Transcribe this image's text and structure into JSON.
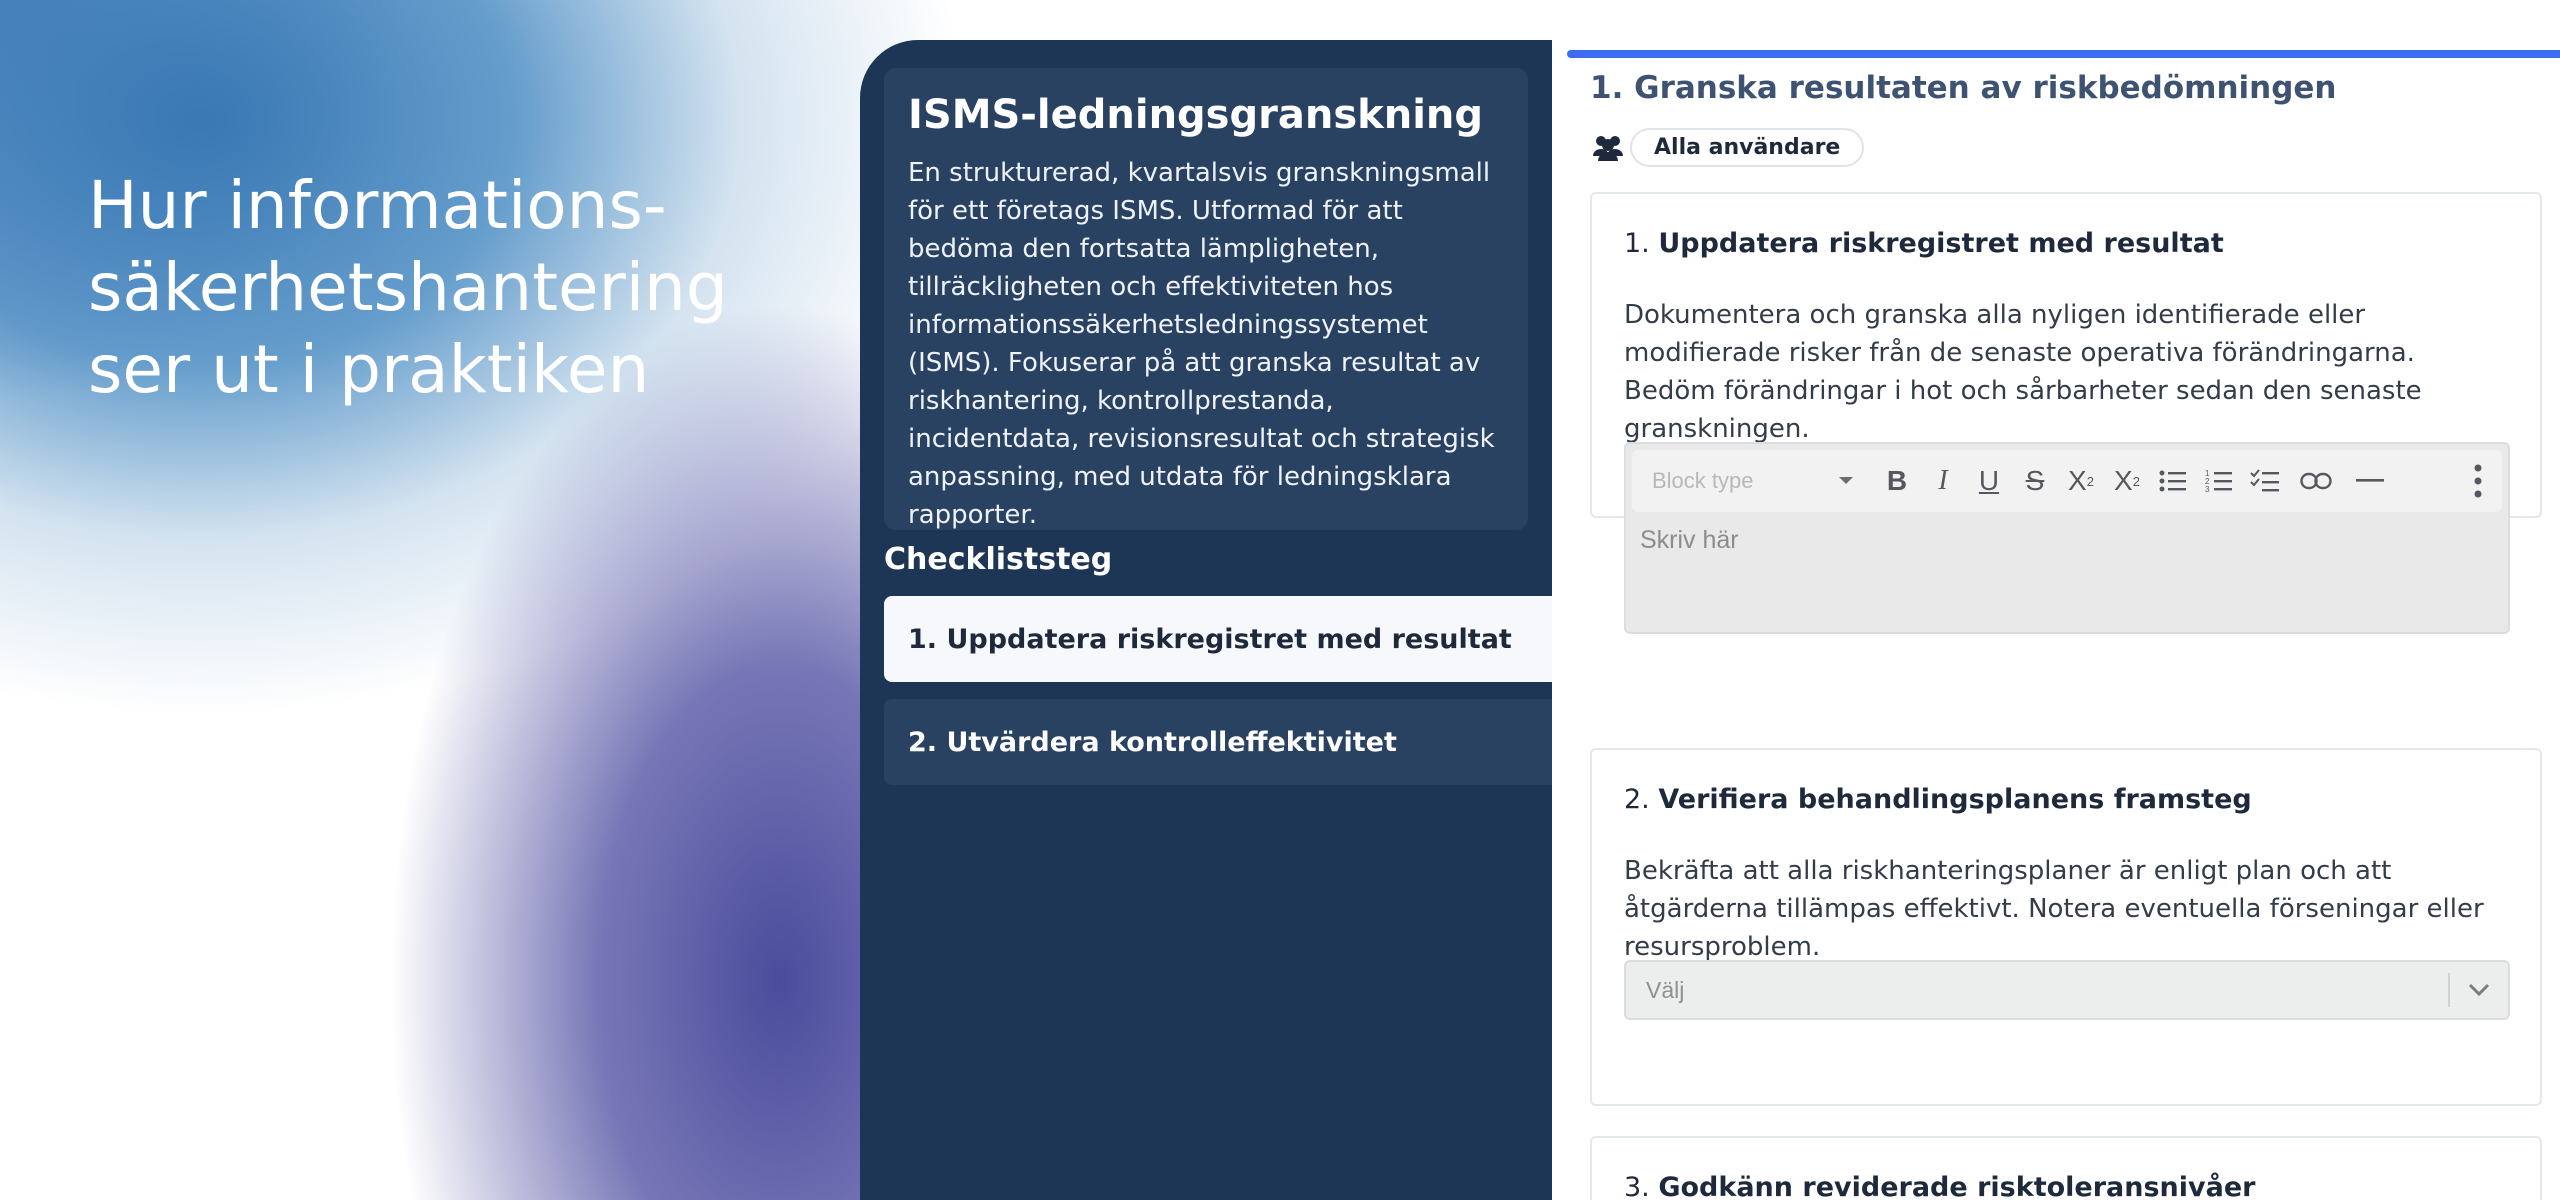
{
  "hero": {
    "line1": "Hur informations-",
    "line2": "säkerhetshantering",
    "line3": "ser ut i praktiken"
  },
  "sidebar": {
    "title": "ISMS-ledningsgranskning",
    "description": "En strukturerad, kvartalsvis granskningsmall för ett företags ISMS. Utformad för att bedöma den fortsatta lämpligheten, tillräckligheten och effektiviteten hos informationssäkerhetsledningssystemet (ISMS). Fokuserar på att granska resultat av riskhantering, kontrollprestanda, incidentdata, revisionsresultat och strategisk anpassning, med utdata för ledningsklara rapporter.",
    "steps_label": "Checkliststeg",
    "steps": [
      {
        "label": "1. Uppdatera riskregistret med resultat",
        "active": true
      },
      {
        "label": "2. Utvärdera kontrolleffektivitet",
        "active": false
      }
    ]
  },
  "main": {
    "section_title": "1. Granska resultaten av riskbedömningen",
    "assignee": "Alla användare",
    "tasks": [
      {
        "number": "1.",
        "title": "Uppdatera riskregistret med resultat",
        "description": "Dokumentera och granska alla nyligen identifierade eller modifierade risker från de senaste operativa förändringarna. Bedöm förändringar i hot och sårbarheter sedan den senaste granskningen.",
        "editor": {
          "block_type": "Block type",
          "placeholder": "Skriv här"
        }
      },
      {
        "number": "2.",
        "title": "Verifiera behandlingsplanens framsteg",
        "description": "Bekräfta att alla riskhanteringsplaner är enligt plan och att åtgärderna tillämpas effektivt. Notera eventuella förseningar eller resursproblem.",
        "select": {
          "placeholder": "Välj"
        }
      },
      {
        "number": "3.",
        "title": "Godkänn reviderade risktoleransnivåer"
      }
    ]
  },
  "colors": {
    "panel": "#1e3655",
    "card": "#2a4262",
    "progress": "#3d6cf0",
    "title": "#3e5371"
  }
}
